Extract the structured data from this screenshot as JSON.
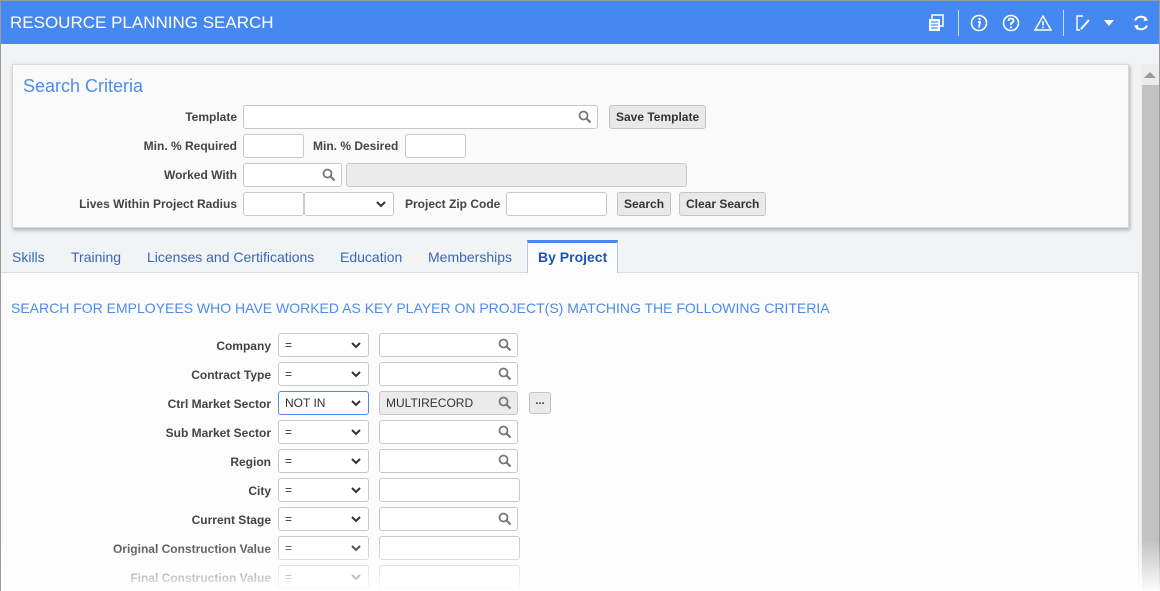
{
  "header": {
    "title": "RESOURCE PLANNING SEARCH",
    "icons": [
      "report-icon",
      "info-icon",
      "help-icon",
      "warning-icon",
      "edit-note-icon",
      "dropdown-arrow-icon",
      "refresh-icon"
    ]
  },
  "criteria": {
    "title": "Search Criteria",
    "template_label": "Template",
    "template_value": "",
    "save_template": "Save Template",
    "min_required_label": "Min. % Required",
    "min_required_value": "",
    "min_desired_label": "Min. % Desired",
    "min_desired_value": "",
    "worked_with_label": "Worked With",
    "worked_with_value": "",
    "worked_with_desc": "",
    "radius_label": "Lives Within Project Radius",
    "radius_value": "",
    "radius_unit": "",
    "zip_label": "Project Zip Code",
    "zip_value": "",
    "search": "Search",
    "clear_search": "Clear Search"
  },
  "tabs": [
    {
      "label": "Skills",
      "active": false
    },
    {
      "label": "Training",
      "active": false
    },
    {
      "label": "Licenses and Certifications",
      "active": false
    },
    {
      "label": "Education",
      "active": false
    },
    {
      "label": "Memberships",
      "active": false
    },
    {
      "label": "By Project",
      "active": true
    }
  ],
  "by_project": {
    "heading": "SEARCH FOR EMPLOYEES WHO HAVE WORKED AS KEY PLAYER ON PROJECT(S) MATCHING THE FOLLOWING CRITERIA",
    "rows": [
      {
        "label": "Company",
        "operator": "=",
        "value": "",
        "lookup": true
      },
      {
        "label": "Contract Type",
        "operator": "=",
        "value": "",
        "lookup": true
      },
      {
        "label": "Ctrl Market Sector",
        "operator": "NOT IN",
        "value": "MULTIRECORD",
        "lookup": true,
        "ellipsis": "..."
      },
      {
        "label": "Sub Market Sector",
        "operator": "=",
        "value": "",
        "lookup": true
      },
      {
        "label": "Region",
        "operator": "=",
        "value": "",
        "lookup": true
      },
      {
        "label": "City",
        "operator": "=",
        "value": "",
        "lookup": false
      },
      {
        "label": "Current Stage",
        "operator": "=",
        "value": "",
        "lookup": true
      },
      {
        "label": "Original Construction Value",
        "operator": "=",
        "value": "",
        "lookup": false
      },
      {
        "label": "Final Construction Value",
        "operator": "=",
        "value": "",
        "lookup": false
      }
    ]
  }
}
